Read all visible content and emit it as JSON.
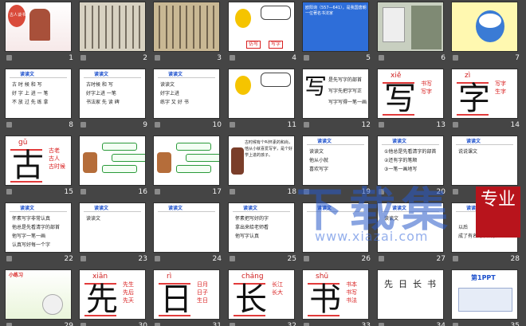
{
  "slides": [
    {
      "num": "1",
      "kind": "title",
      "bg": "#ffffff",
      "title": "古人谈书法"
    },
    {
      "num": "2",
      "kind": "callig",
      "bg": "#d8d2c2"
    },
    {
      "num": "3",
      "kind": "callig",
      "bg": "#c9b894"
    },
    {
      "num": "4",
      "kind": "cartoon",
      "bg": "#ffffff",
      "a": "仿写",
      "b": "写字"
    },
    {
      "num": "5",
      "kind": "bluetext",
      "bg": "#2e6ed9",
      "text": "欧阳询（557—641），是我国唐朝一位著名书法家"
    },
    {
      "num": "6",
      "kind": "photo",
      "bg": "#c8cfc0"
    },
    {
      "num": "7",
      "kind": "donald",
      "bg": "#fff8b0"
    },
    {
      "num": "8",
      "kind": "chars",
      "bg": "#ffffff",
      "lines": [
        "古 时 候 和 写",
        "好 字 上 进 一 笔",
        "不 放 过 先 练 拿"
      ]
    },
    {
      "num": "9",
      "kind": "chars",
      "bg": "#ffffff",
      "lines": [
        "古时候 和 写",
        "好字上进 一笔",
        "书法家 先 读 碑"
      ]
    },
    {
      "num": "10",
      "kind": "chars",
      "bg": "#ffffff",
      "lines": [
        "读读文",
        "好字上进",
        "练字 又 好 书"
      ]
    },
    {
      "num": "11",
      "kind": "cartoon2",
      "bg": "#ffffff"
    },
    {
      "num": "12",
      "kind": "single",
      "bg": "#ffffff",
      "char": "写",
      "py": "",
      "lines": [
        "是先写字的部首",
        "写字先把字写正",
        "写字写得一笔一画"
      ]
    },
    {
      "num": "13",
      "kind": "big",
      "bg": "#ffffff",
      "char": "写",
      "py": "xiě",
      "tags": [
        "书写",
        "写字"
      ]
    },
    {
      "num": "14",
      "kind": "big",
      "bg": "#ffffff",
      "char": "字",
      "py": "zì",
      "tags": [
        "写字",
        "生字"
      ]
    },
    {
      "num": "15",
      "kind": "big",
      "bg": "#ffffff",
      "char": "古",
      "py": "gǔ",
      "tags": [
        "古老",
        "古人",
        "古时候"
      ]
    },
    {
      "num": "16",
      "kind": "cards",
      "bg": "#ffffff"
    },
    {
      "num": "17",
      "kind": "cards2",
      "bg": "#ffffff"
    },
    {
      "num": "18",
      "kind": "story",
      "bg": "#ffffff",
      "text": "古时候有个叫怀素的和尚，他从小就喜爱写字，是个好学上进的孩子。"
    },
    {
      "num": "19",
      "kind": "chars",
      "bg": "#ffffff",
      "lines": [
        "读读文",
        "他从小就",
        "喜欢写字"
      ]
    },
    {
      "num": "20",
      "kind": "chars",
      "bg": "#ffffff",
      "lines": [
        "①他总是先看清字的部首",
        "②还有字的笔顺",
        "③一笔一画地写"
      ]
    },
    {
      "num": "21",
      "kind": "chars",
      "bg": "#ffffff",
      "lines": [
        "说说课文",
        "",
        ""
      ]
    },
    {
      "num": "22",
      "kind": "chars",
      "bg": "#ffffff",
      "lines": [
        "怀素写字非常认真",
        "他总是先看清字的部首",
        "他写字一笔一画",
        "认真写好每一个字"
      ]
    },
    {
      "num": "23",
      "kind": "chars",
      "bg": "#ffffff",
      "lines": [
        "读读文",
        "",
        ""
      ]
    },
    {
      "num": "24",
      "kind": "reading",
      "bg": "#ffffff"
    },
    {
      "num": "25",
      "kind": "chars",
      "bg": "#ffffff",
      "lines": [
        "怀素把写好的字",
        "拿出来给老师看",
        "他写字认真"
      ]
    },
    {
      "num": "26",
      "kind": "reading",
      "bg": "#ffffff"
    },
    {
      "num": "27",
      "kind": "chars",
      "bg": "#ffffff",
      "lines": [
        "读读文",
        "",
        ""
      ]
    },
    {
      "num": "28",
      "kind": "chars",
      "bg": "#ffffff",
      "lines": [
        "",
        "以后",
        "成了有名的书法家"
      ]
    },
    {
      "num": "29",
      "kind": "rabbit",
      "bg": "#ffffff"
    },
    {
      "num": "30",
      "kind": "big",
      "bg": "#ffffff",
      "char": "先",
      "py": "xiān",
      "tags": [
        "先生",
        "先后",
        "先天"
      ]
    },
    {
      "num": "31",
      "kind": "big",
      "bg": "#ffffff",
      "char": "日",
      "py": "rì",
      "tags": [
        "日月",
        "日子",
        "生日"
      ]
    },
    {
      "num": "32",
      "kind": "big",
      "bg": "#ffffff",
      "char": "长",
      "py": "cháng",
      "tags": [
        "长江",
        "长大"
      ]
    },
    {
      "num": "33",
      "kind": "big",
      "bg": "#ffffff",
      "char": "书",
      "py": "shū",
      "tags": [
        "书本",
        "书写",
        "书法"
      ]
    },
    {
      "num": "34",
      "kind": "list",
      "bg": "#ffffff"
    },
    {
      "num": "35",
      "kind": "ppt",
      "bg": "#ffffff",
      "title": "第1PPT"
    }
  ],
  "watermark": {
    "main": "下载集",
    "seal": "专业",
    "url": "www.xiazai.com"
  },
  "colors": {
    "accent": "#d81e1e",
    "bg": "#454545"
  }
}
